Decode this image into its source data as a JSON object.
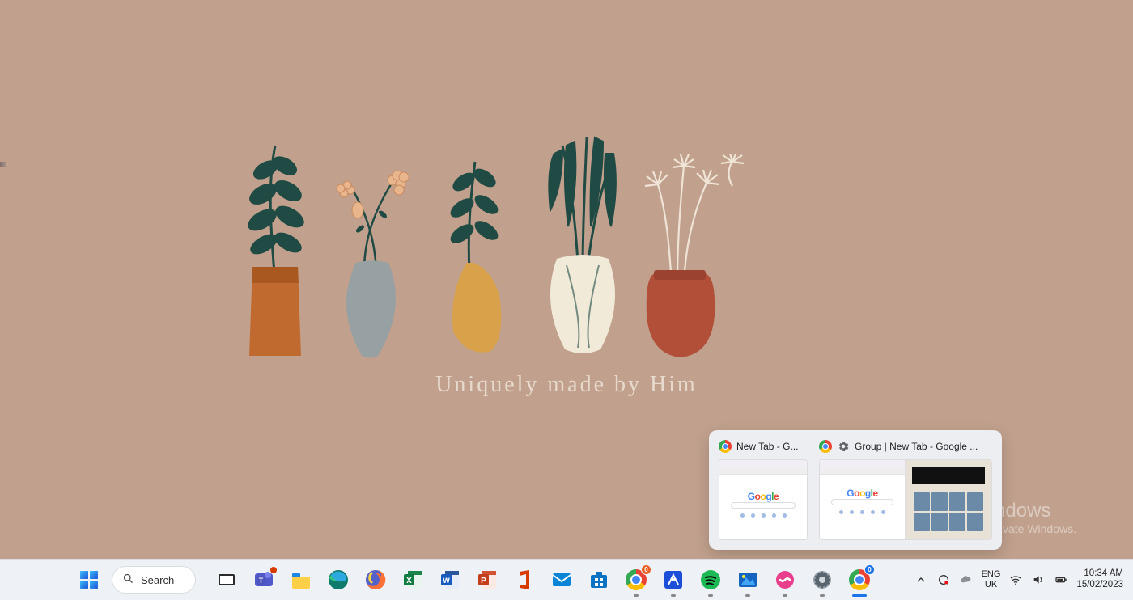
{
  "wallpaper": {
    "caption": "Uniquely made by Him"
  },
  "activation": {
    "title": "Activate Windows",
    "subtitle": "Go to Settings to activate Windows."
  },
  "preview_popup": {
    "items": [
      {
        "title": "New Tab - G...",
        "favicon": "chrome-icon"
      },
      {
        "title": "Group | New Tab - Google ...",
        "favicon": "chrome-icon",
        "secondary_icon": "gear-icon"
      }
    ]
  },
  "taskbar": {
    "search_label": "Search",
    "apps": [
      {
        "name": "task-view",
        "running": false
      },
      {
        "name": "teams",
        "running": false
      },
      {
        "name": "file-explorer",
        "running": false
      },
      {
        "name": "edge",
        "running": false
      },
      {
        "name": "firefox",
        "running": false
      },
      {
        "name": "excel",
        "running": false
      },
      {
        "name": "word",
        "running": false
      },
      {
        "name": "powerpoint",
        "running": false
      },
      {
        "name": "office",
        "running": false
      },
      {
        "name": "mail",
        "running": false
      },
      {
        "name": "microsoft-store",
        "running": false
      },
      {
        "name": "chrome-1",
        "running": true,
        "badge": "0"
      },
      {
        "name": "tool-app",
        "running": true
      },
      {
        "name": "spotify",
        "running": true
      },
      {
        "name": "photos",
        "running": true
      },
      {
        "name": "pink-app",
        "running": true
      },
      {
        "name": "settings",
        "running": true
      },
      {
        "name": "chrome-2",
        "running": true,
        "badge": "0"
      }
    ],
    "language": {
      "line1": "ENG",
      "line2": "UK"
    },
    "clock": {
      "time": "10:34 AM",
      "date": "15/02/2023"
    }
  },
  "colors": {
    "wallpaper_bg": "#c1a18d",
    "taskbar_bg": "#eef1f6"
  }
}
